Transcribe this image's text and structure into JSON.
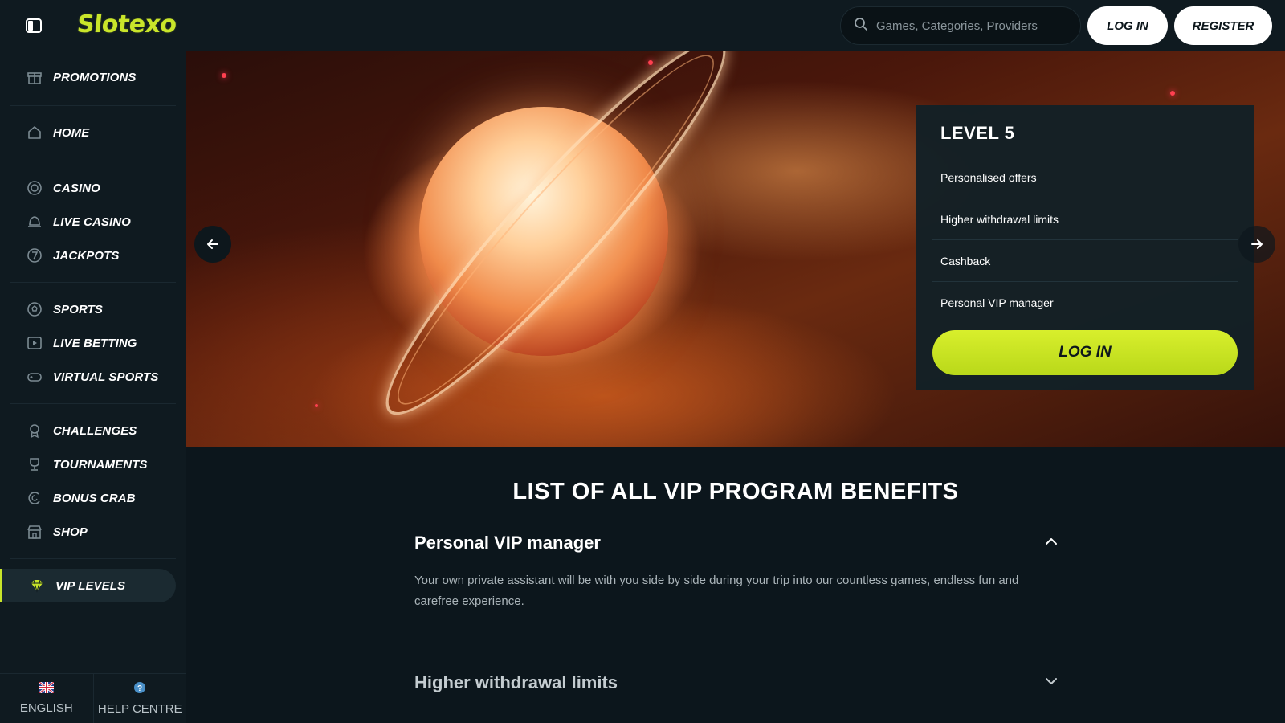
{
  "header": {
    "logo_text": "Slotexo",
    "search_placeholder": "Games, Categories, Providers",
    "login_label": "LOG IN",
    "register_label": "REGISTER"
  },
  "sidebar": {
    "items": [
      {
        "label": "PROMOTIONS",
        "icon": "gift-icon"
      },
      {
        "label": "HOME",
        "icon": "home-icon"
      },
      {
        "label": "CASINO",
        "icon": "chip-icon"
      },
      {
        "label": "LIVE CASINO",
        "icon": "bell-icon"
      },
      {
        "label": "JACKPOTS",
        "icon": "seven-icon"
      },
      {
        "label": "SPORTS",
        "icon": "soccer-ball-icon"
      },
      {
        "label": "LIVE BETTING",
        "icon": "play-icon"
      },
      {
        "label": "VIRTUAL SPORTS",
        "icon": "gamepad-icon"
      },
      {
        "label": "CHALLENGES",
        "icon": "medal-icon"
      },
      {
        "label": "TOURNAMENTS",
        "icon": "trophy-icon"
      },
      {
        "label": "BONUS CRAB",
        "icon": "claw-icon"
      },
      {
        "label": "SHOP",
        "icon": "shop-icon"
      },
      {
        "label": "VIP LEVELS",
        "icon": "diamond-icon"
      }
    ],
    "active": "VIP LEVELS",
    "footer": {
      "language_label": "ENGLISH",
      "help_label": "HELP CENTRE"
    }
  },
  "hero": {
    "level_card": {
      "title": "LEVEL 5",
      "benefits": [
        "Personalised offers",
        "Higher withdrawal limits",
        "Cashback",
        "Personal VIP manager"
      ],
      "login_label": "LOG IN"
    }
  },
  "benefits_section": {
    "title": "LIST OF ALL VIP PROGRAM BENEFITS",
    "accordion": [
      {
        "question": "Personal VIP manager",
        "expanded": true,
        "answer": "Your own private assistant will be with you side by side during your trip into our countless games, endless fun and carefree experience."
      },
      {
        "question": "Higher withdrawal limits",
        "expanded": false
      }
    ]
  },
  "colors": {
    "accent": "#c9e52a",
    "background": "#0c161c",
    "sidebar": "#0f1a20"
  }
}
